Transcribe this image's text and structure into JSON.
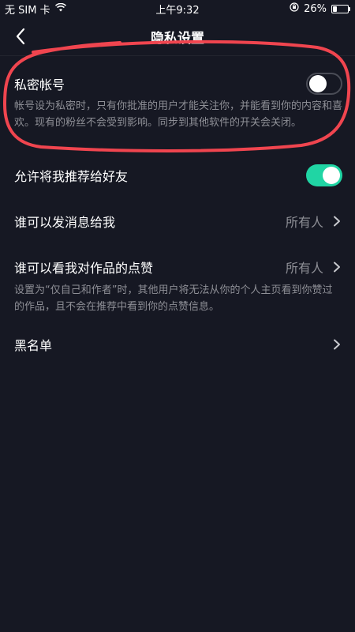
{
  "status_bar": {
    "carrier": "无 SIM 卡",
    "wifi_icon": "wifi-icon",
    "time": "上午9:32",
    "orientation_lock_icon": "orientation-lock-icon",
    "battery_text": "26%",
    "battery_level": 0.26
  },
  "nav": {
    "title": "隐私设置",
    "back_icon": "chevron-left-icon"
  },
  "settings": {
    "private_account": {
      "label": "私密帐号",
      "enabled": false,
      "description": "帐号设为私密时，只有你批准的用户才能关注你，并能看到你的内容和喜欢。现有的粉丝不会受到影响。同步到其他软件的开关会关闭。"
    },
    "recommend_to_friends": {
      "label": "允许将我推荐给好友",
      "enabled": true
    },
    "who_can_message": {
      "label": "谁可以发消息给我",
      "value": "所有人"
    },
    "who_can_see_likes": {
      "label": "谁可以看我对作品的点赞",
      "value": "所有人",
      "description": "设置为“仅自己和作者”时，其他用户将无法从你的个人主页看到你赞过的作品，且不会在推荐中看到你的点赞信息。"
    },
    "blacklist": {
      "label": "黑名单"
    }
  },
  "colors": {
    "background": "#161823",
    "toggle_on": "#20d5a4",
    "secondary_text": "#8e8f96",
    "annotation": "#f0454f"
  }
}
